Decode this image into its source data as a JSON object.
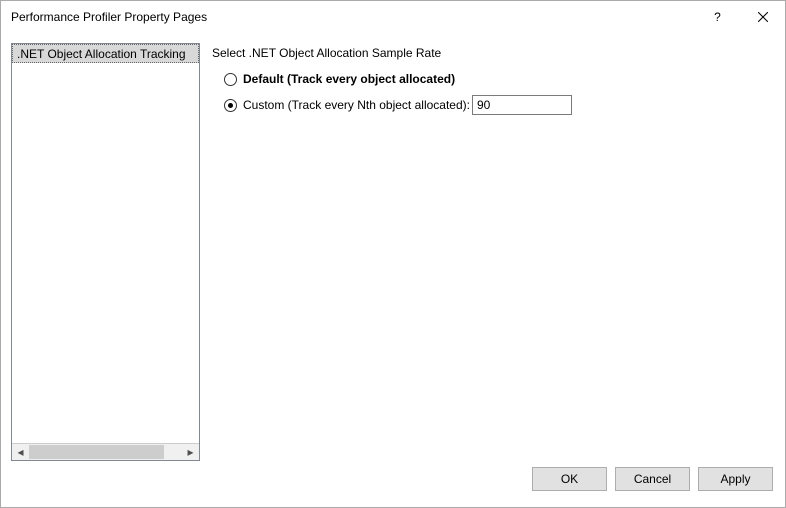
{
  "window": {
    "title": "Performance Profiler Property Pages"
  },
  "sidebar": {
    "items": [
      {
        "label": ".NET Object Allocation Tracking"
      }
    ]
  },
  "main": {
    "heading": "Select .NET Object Allocation Sample Rate",
    "options": {
      "default": {
        "label": "Default (Track every object allocated)",
        "selected": false
      },
      "custom": {
        "label": "Custom (Track every Nth object allocated):",
        "selected": true,
        "value": "90"
      }
    }
  },
  "footer": {
    "ok": "OK",
    "cancel": "Cancel",
    "apply": "Apply"
  }
}
